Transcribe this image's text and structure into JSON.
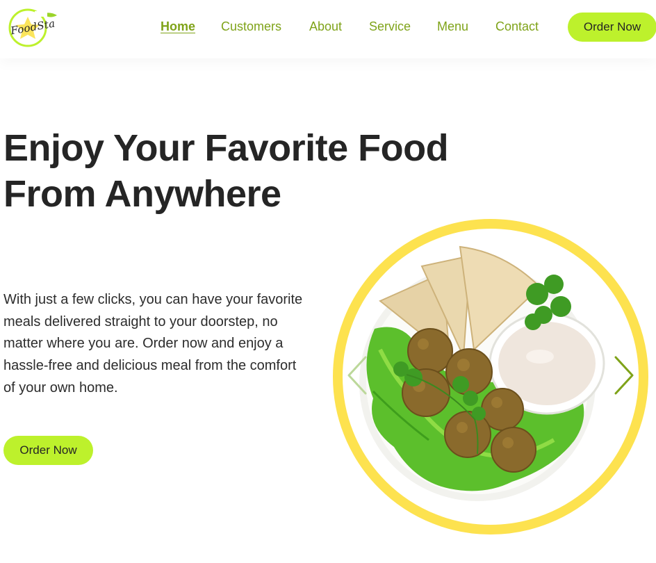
{
  "brand": {
    "name": "FoodSta",
    "logo_icon": "star-leaf-logo-icon"
  },
  "nav": {
    "items": [
      {
        "label": "Home",
        "active": true
      },
      {
        "label": "Customers",
        "active": false
      },
      {
        "label": "About",
        "active": false
      },
      {
        "label": "Service",
        "active": false
      },
      {
        "label": "Menu",
        "active": false
      },
      {
        "label": "Contact",
        "active": false
      }
    ],
    "cta_label": "Order Now"
  },
  "hero": {
    "title_line1": "Enjoy Your Favorite Food",
    "title_line2": "From Anywhere",
    "description": "With just a few clicks, you can have your favorite meals delivered straight to your doorstep, no matter where you are. Order now and enjoy a hassle-free and delicious meal from the comfort of your own home.",
    "cta_label": "Order Now",
    "image": {
      "subject": "falafel plate with pita bread and sauce"
    },
    "carousel": {
      "prev_icon": "chevron-left-icon",
      "next_icon": "chevron-right-icon"
    }
  },
  "colors": {
    "accent": "#bdf12c",
    "nav_text": "#7fa319",
    "ring": "#fde24f",
    "heading": "#252525"
  }
}
